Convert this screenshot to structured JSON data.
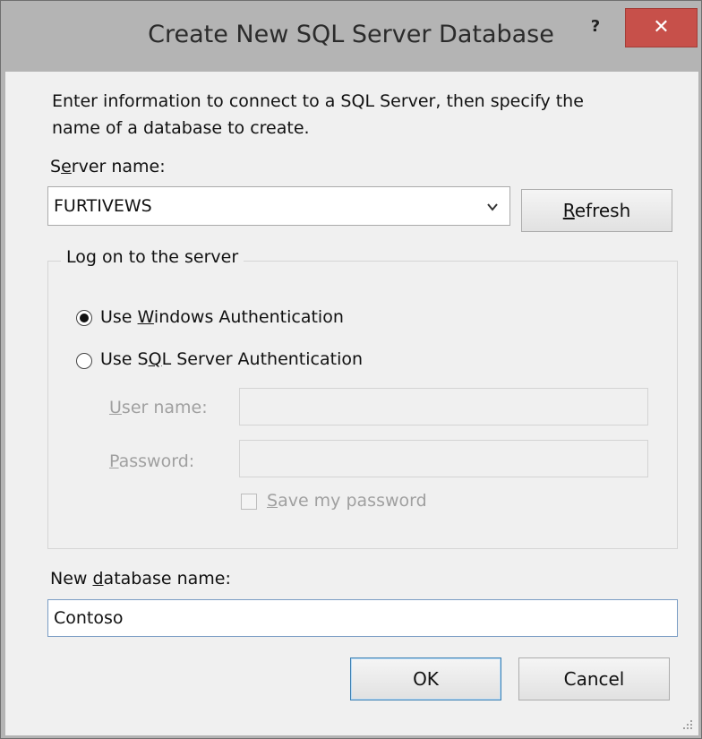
{
  "window": {
    "title": "Create New SQL Server Database",
    "help_label": "?",
    "close_label": "✕"
  },
  "instructions": "Enter information to connect to a SQL Server, then specify the",
  "instructions_line2": "name of a database to create.",
  "server": {
    "label_pre": "S",
    "label_ul": "e",
    "label_post": "rver name:",
    "value": "FURTIVEWS",
    "refresh_pre": "",
    "refresh_ul": "R",
    "refresh_post": "efresh"
  },
  "logon": {
    "legend": "Log on to the server",
    "windows_auth": {
      "pre": "Use ",
      "ul": "W",
      "post": "indows Authentication",
      "selected": true
    },
    "sql_auth": {
      "pre": "Use S",
      "ul": "Q",
      "post": "L Server Authentication",
      "selected": false
    },
    "user_name": {
      "ul": "U",
      "post": "ser name:",
      "value": ""
    },
    "password": {
      "ul": "P",
      "post": "assword:",
      "value": ""
    },
    "save_password": {
      "ul": "S",
      "post": "ave my password",
      "checked": false
    }
  },
  "database": {
    "label_pre": "New ",
    "label_ul": "d",
    "label_post": "atabase name:",
    "value": "Contoso"
  },
  "buttons": {
    "ok": "OK",
    "cancel": "Cancel"
  }
}
